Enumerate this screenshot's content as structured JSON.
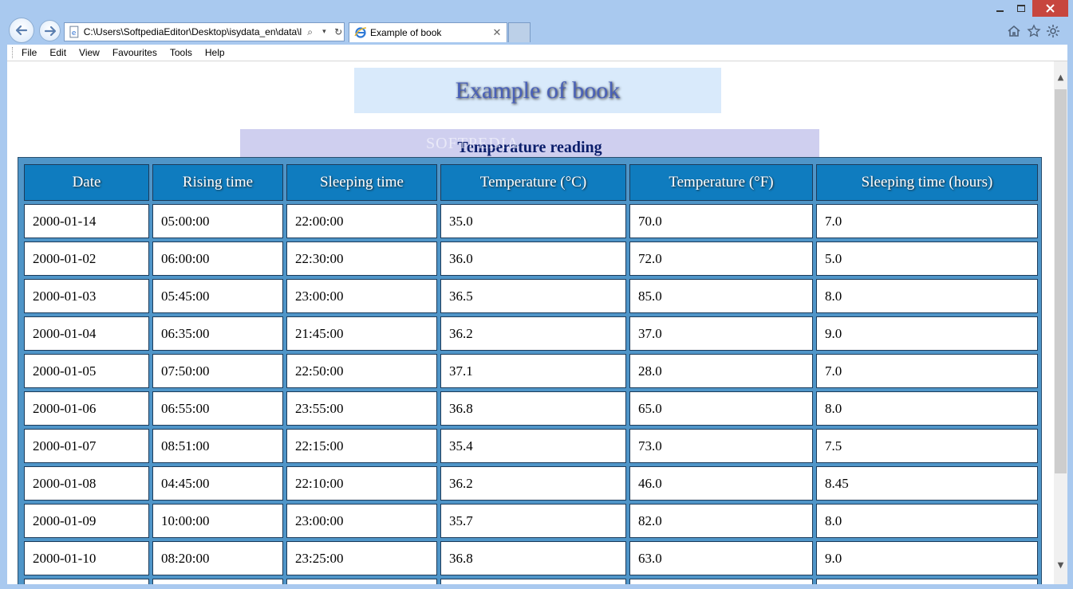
{
  "browser": {
    "address_url": "C:\\Users\\SoftpediaEditor\\Desktop\\isydata_en\\data\\l",
    "tab_title": "Example of book",
    "menu": [
      "File",
      "Edit",
      "View",
      "Favourites",
      "Tools",
      "Help"
    ]
  },
  "page": {
    "title": "Example of book",
    "caption": "Temperature reading",
    "watermark": "SOFTPEDIA"
  },
  "table": {
    "headers": [
      "Date",
      "Rising time",
      "Sleeping time",
      "Temperature (°C)",
      "Temperature (°F)",
      "Sleeping time (hours)"
    ],
    "rows": [
      [
        "2000-01-14",
        "05:00:00",
        "22:00:00",
        "35.0",
        "70.0",
        "7.0"
      ],
      [
        "2000-01-02",
        "06:00:00",
        "22:30:00",
        "36.0",
        "72.0",
        "5.0"
      ],
      [
        "2000-01-03",
        "05:45:00",
        "23:00:00",
        "36.5",
        "85.0",
        "8.0"
      ],
      [
        "2000-01-04",
        "06:35:00",
        "21:45:00",
        "36.2",
        "37.0",
        "9.0"
      ],
      [
        "2000-01-05",
        "07:50:00",
        "22:50:00",
        "37.1",
        "28.0",
        "7.0"
      ],
      [
        "2000-01-06",
        "06:55:00",
        "23:55:00",
        "36.8",
        "65.0",
        "8.0"
      ],
      [
        "2000-01-07",
        "08:51:00",
        "22:15:00",
        "35.4",
        "73.0",
        "7.5"
      ],
      [
        "2000-01-08",
        "04:45:00",
        "22:10:00",
        "36.2",
        "46.0",
        "8.45"
      ],
      [
        "2000-01-09",
        "10:00:00",
        "23:00:00",
        "35.7",
        "82.0",
        "8.0"
      ],
      [
        "2000-01-10",
        "08:20:00",
        "23:25:00",
        "36.8",
        "63.0",
        "9.0"
      ],
      [
        "",
        "",
        "",
        "",
        "",
        ""
      ]
    ]
  },
  "colors": {
    "chrome": "#a9c9ef",
    "header_cell": "#0f7cbf",
    "table_bg": "#4f95c8",
    "close_button": "#c7463e"
  },
  "icons": [
    "back-arrow-icon",
    "forward-arrow-icon",
    "page-icon",
    "search-icon",
    "dropdown-icon",
    "refresh-icon",
    "ie-icon",
    "close-icon",
    "home-icon",
    "star-icon",
    "gear-icon"
  ]
}
